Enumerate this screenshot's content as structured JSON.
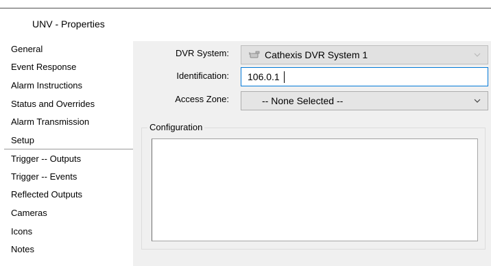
{
  "window": {
    "title": "UNV - Properties"
  },
  "sidebar": {
    "items": [
      {
        "label": "General"
      },
      {
        "label": "Event Response"
      },
      {
        "label": "Alarm Instructions"
      },
      {
        "label": "Status and Overrides"
      },
      {
        "label": "Alarm Transmission"
      },
      {
        "label": "Setup",
        "selected": true
      },
      {
        "label": "Trigger -- Outputs"
      },
      {
        "label": "Trigger -- Events"
      },
      {
        "label": "Reflected Outputs"
      },
      {
        "label": "Cameras"
      },
      {
        "label": "Icons"
      },
      {
        "label": "Notes"
      }
    ]
  },
  "form": {
    "dvr_system": {
      "label": "DVR System:",
      "value": "Cathexis DVR System 1",
      "icon": "camera-icon",
      "enabled": false
    },
    "identification": {
      "label": "Identification:",
      "value": "106.0.1"
    },
    "access_zone": {
      "label": "Access Zone:",
      "value": "-- None Selected --",
      "enabled": true
    }
  },
  "configuration": {
    "legend": "Configuration",
    "text": ""
  },
  "colors": {
    "focus_border": "#0078d7",
    "panel_bg": "#f0f0f0",
    "selected_bg": "#ffffff"
  }
}
